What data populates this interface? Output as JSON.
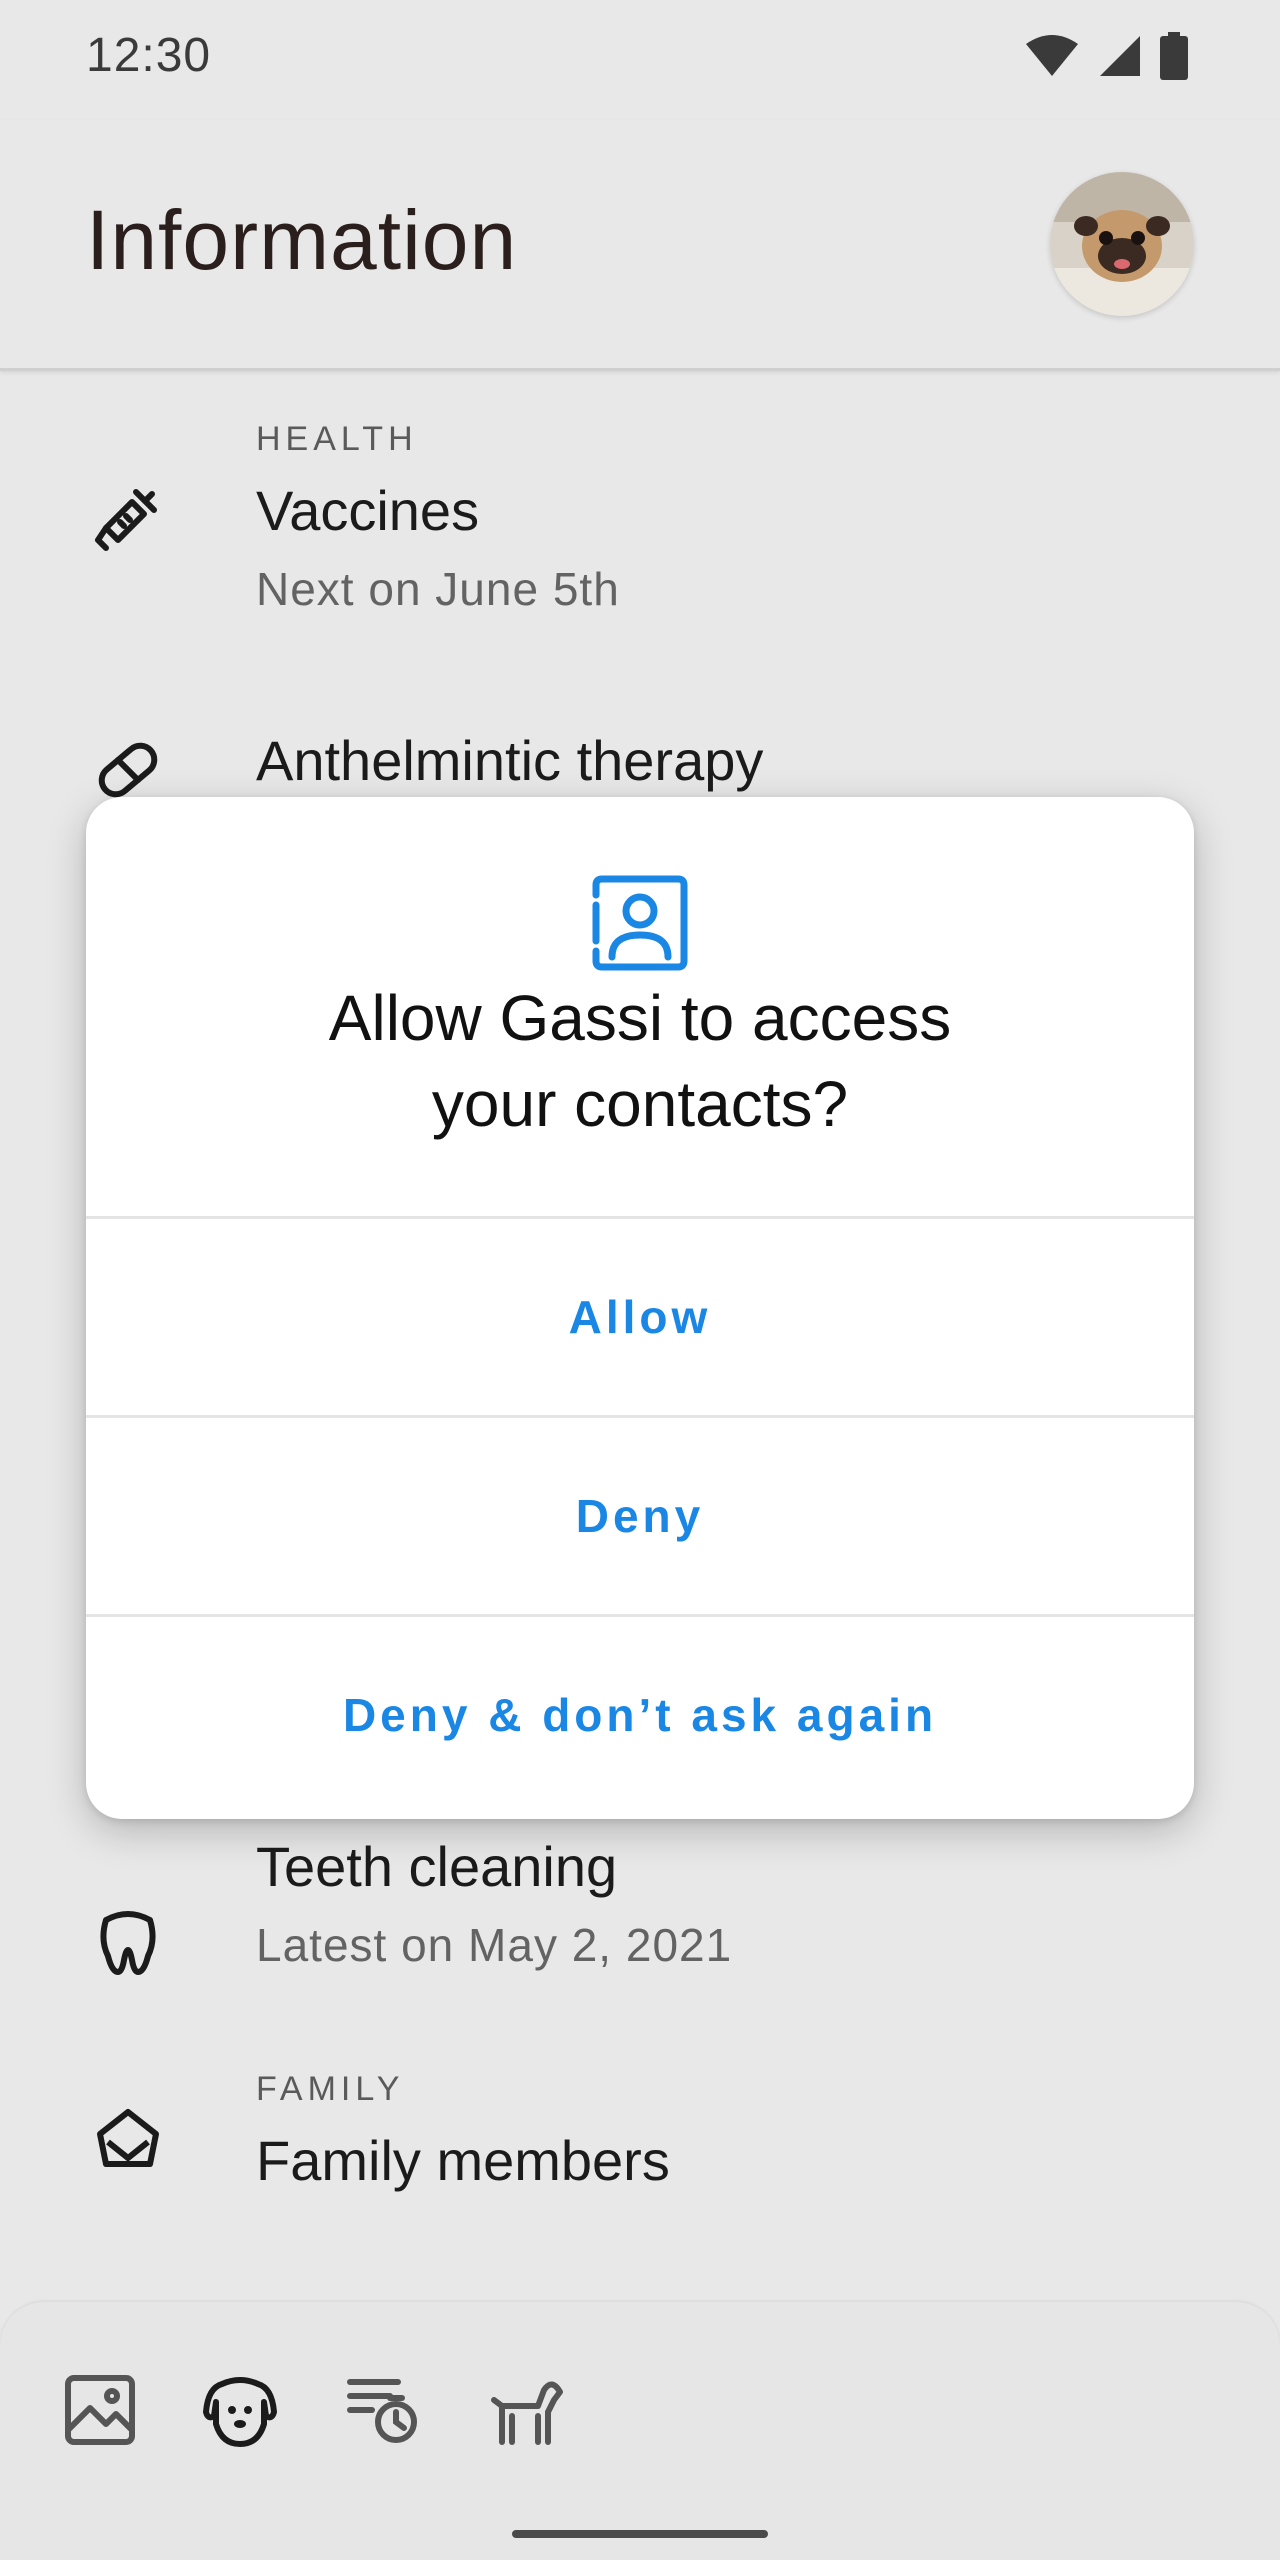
{
  "status_bar": {
    "time": "12:30",
    "icons": [
      "wifi-icon",
      "signal-icon",
      "battery-icon"
    ]
  },
  "header": {
    "title": "Information",
    "avatar": "pug-avatar"
  },
  "list": {
    "health_overline": "HEALTH",
    "vaccines": {
      "title": "Vaccines",
      "subtitle": "Next on June 5th",
      "icon": "syringe-icon"
    },
    "anthelmintic": {
      "title": "Anthelmintic therapy",
      "icon": "pill-icon"
    },
    "teeth": {
      "title": "Teeth cleaning",
      "subtitle": "Latest on May 2, 2021",
      "icon": "tooth-icon"
    },
    "family_overline": "FAMILY",
    "family": {
      "title": "Family members",
      "icon": "family-house-icon"
    }
  },
  "dialog": {
    "icon": "contact-icon",
    "title_line1": "Allow Gassi to access",
    "title_line2": "your contacts?",
    "allow_label": "Allow",
    "deny_label": "Deny",
    "deny_forever_label": "Deny & don’t ask again"
  },
  "bottom_nav": {
    "items": [
      "gallery-icon",
      "dog-face-icon",
      "schedule-timer-icon",
      "dog-icon"
    ]
  },
  "colors": {
    "accent": "#1a87e5",
    "background": "#e8e8e8",
    "surface": "#ffffff"
  }
}
